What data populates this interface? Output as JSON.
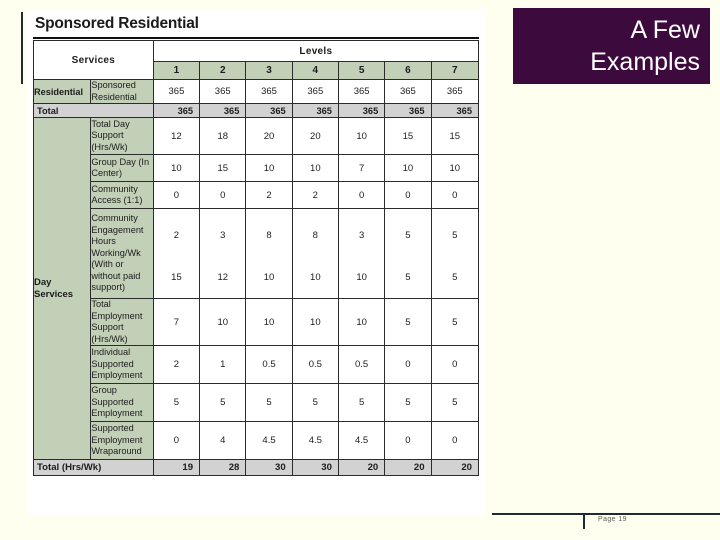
{
  "slide": {
    "title_lines": [
      "A Few",
      "Examples"
    ],
    "accent_color": "#3d0a3d",
    "background_color": "#fffff0",
    "footer": {
      "page_label": "Page 19",
      "rule_color": "#1d2b36"
    }
  },
  "panel": {
    "heading": "Sponsored Residential",
    "header": {
      "services_label": "Services",
      "levels_label": "Levels",
      "level_numbers": [
        "1",
        "2",
        "3",
        "4",
        "5",
        "6",
        "7"
      ]
    },
    "colors": {
      "header_green": "#c3d0b8",
      "total_gray": "#d2d2d2",
      "grid": "#2b2b2b"
    },
    "groups": [
      {
        "name": "Residential",
        "rows": [
          {
            "service": "Sponsored Residential",
            "values": [
              "365",
              "365",
              "365",
              "365",
              "365",
              "365",
              "365"
            ]
          }
        ],
        "total": {
          "label": "Total",
          "values": [
            "365",
            "365",
            "365",
            "365",
            "365",
            "365",
            "365"
          ]
        }
      },
      {
        "name": "Day Services",
        "rows": [
          {
            "service": "Total Day Support (Hrs/Wk)",
            "values": [
              "12",
              "18",
              "20",
              "20",
              "10",
              "15",
              "15"
            ]
          },
          {
            "service": "Group Day (In Center)",
            "values": [
              "10",
              "15",
              "10",
              "10",
              "7",
              "10",
              "10"
            ]
          },
          {
            "service": "Community Access (1:1)",
            "values": [
              "0",
              "0",
              "2",
              "2",
              "0",
              "0",
              "0"
            ]
          },
          {
            "service": "Community Engagement Hours Working/Wk (With or without paid support)",
            "values_top": [
              "2",
              "3",
              "8",
              "8",
              "3",
              "5",
              "5"
            ],
            "values_bottom": [
              "15",
              "12",
              "10",
              "10",
              "10",
              "5",
              "5"
            ]
          },
          {
            "service": "Total Employment Support (Hrs/Wk)",
            "values": [
              "7",
              "10",
              "10",
              "10",
              "10",
              "5",
              "5"
            ]
          },
          {
            "service": "Individual Supported Employment",
            "values": [
              "2",
              "1",
              "0.5",
              "0.5",
              "0.5",
              "0",
              "0"
            ]
          },
          {
            "service": "Group Supported Employment",
            "values": [
              "5",
              "5",
              "5",
              "5",
              "5",
              "5",
              "5"
            ]
          },
          {
            "service": "Supported Employment Wraparound",
            "values": [
              "0",
              "4",
              "4.5",
              "4.5",
              "4.5",
              "0",
              "0"
            ]
          }
        ],
        "total": {
          "label": "Total (Hrs/Wk)",
          "values": [
            "19",
            "28",
            "30",
            "30",
            "20",
            "20",
            "20"
          ]
        }
      }
    ]
  }
}
